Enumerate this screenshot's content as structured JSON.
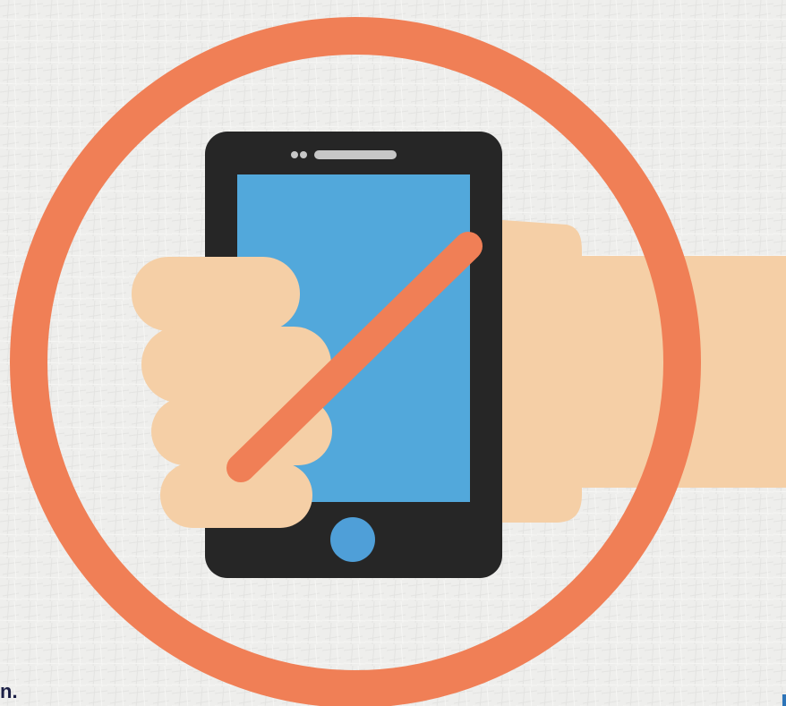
{
  "fragments": {
    "bottom_left_text": "n."
  },
  "icons": {
    "main_symbol": "no-phone-prohibition-icon",
    "phone": "smartphone-icon",
    "hand": "hand-icon",
    "slash": "prohibition-slash-icon",
    "ring": "prohibition-ring-icon"
  },
  "colors": {
    "background": "#eeeeec",
    "ring": "#f07f56",
    "phone_body": "#262626",
    "phone_screen": "#52a8db",
    "home_button": "#4f9fd8",
    "speaker": "#c7c7c7",
    "skin": "#f5cfa6",
    "text": "#1b1f45"
  }
}
